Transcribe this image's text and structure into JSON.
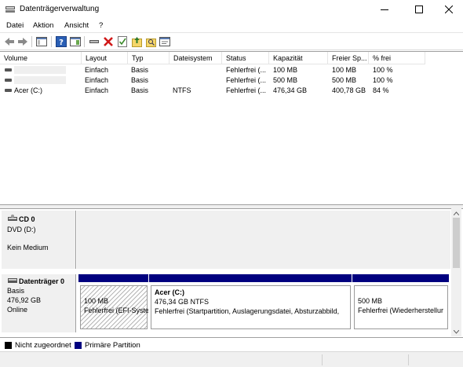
{
  "window": {
    "title": "Datenträgerverwaltung"
  },
  "menu": {
    "file": "Datei",
    "action": "Aktion",
    "view": "Ansicht",
    "help": "?"
  },
  "columns": [
    "Volume",
    "Layout",
    "Typ",
    "Dateisystem",
    "Status",
    "Kapazität",
    "Freier Sp...",
    "% frei"
  ],
  "volumes": [
    {
      "volume": "",
      "layout": "Einfach",
      "type": "Basis",
      "fs": "",
      "status": "Fehlerfrei (...",
      "capacity": "100 MB",
      "free": "100 MB",
      "pct": "100 %"
    },
    {
      "volume": "",
      "layout": "Einfach",
      "type": "Basis",
      "fs": "",
      "status": "Fehlerfrei (...",
      "capacity": "500 MB",
      "free": "500 MB",
      "pct": "100 %"
    },
    {
      "volume": "Acer (C:)",
      "layout": "Einfach",
      "type": "Basis",
      "fs": "NTFS",
      "status": "Fehlerfrei (...",
      "capacity": "476,34 GB",
      "free": "400,78 GB",
      "pct": "84 %"
    }
  ],
  "disks": {
    "cd0": {
      "name": "CD 0",
      "line2": "DVD (D:)",
      "line3": "Kein Medium"
    },
    "disk0": {
      "name": "Datenträger 0",
      "type": "Basis",
      "size": "476,92 GB",
      "state": "Online",
      "partitions": [
        {
          "title": "",
          "size": "100 MB",
          "status": "Fehlerfrei (EFI-Syste"
        },
        {
          "title": "Acer  (C:)",
          "size": "476,34 GB NTFS",
          "status": "Fehlerfrei (Startpartition, Auslagerungsdatei, Absturzabbild,"
        },
        {
          "title": "",
          "size": "500 MB",
          "status": "Fehlerfrei (Wiederherstellur"
        }
      ]
    }
  },
  "legend": {
    "unallocated": "Nicht zugeordnet",
    "primary": "Primäre Partition",
    "unallocated_color": "#000000",
    "primary_color": "#00007f"
  }
}
